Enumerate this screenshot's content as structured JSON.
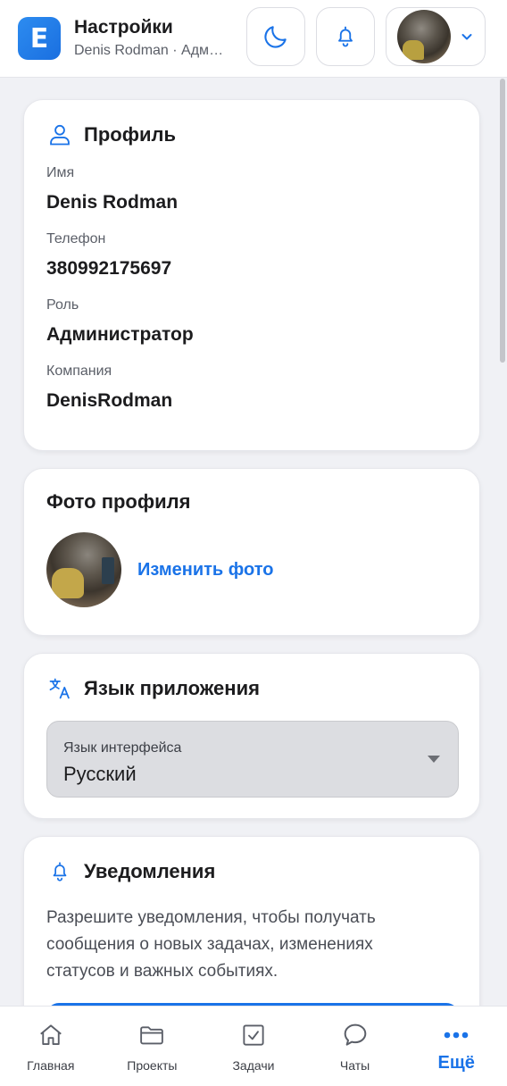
{
  "header": {
    "logo_letter": "E",
    "title": "Настройки",
    "subtitle": "Denis Rodman · Администратор"
  },
  "profile": {
    "title": "Профиль",
    "fields": [
      {
        "label": "Имя",
        "value": "Denis Rodman"
      },
      {
        "label": "Телефон",
        "value": "380992175697"
      },
      {
        "label": "Роль",
        "value": "Администратор"
      },
      {
        "label": "Компания",
        "value": "DenisRodman"
      }
    ]
  },
  "photo": {
    "title": "Фото профиля",
    "change_label": "Изменить фото"
  },
  "language": {
    "title": "Язык приложения",
    "select_label": "Язык интерфейса",
    "select_value": "Русский"
  },
  "notifications": {
    "title": "Уведомления",
    "text": "Разрешите уведомления, чтобы получать сообщения о новых задачах, изменениях статусов и важных событиях."
  },
  "bottom_nav": [
    {
      "label": "Главная",
      "icon": "home-icon"
    },
    {
      "label": "Проекты",
      "icon": "folder-icon"
    },
    {
      "label": "Задачи",
      "icon": "task-check-icon"
    },
    {
      "label": "Чаты",
      "icon": "chat-icon"
    },
    {
      "label": "Ещё",
      "icon": "more-dots-icon",
      "active": true
    }
  ],
  "colors": {
    "accent": "#1a73e8",
    "background": "#f0f1f5",
    "card": "#ffffff",
    "text": "#1c1c1e",
    "muted": "#5b5f68"
  }
}
